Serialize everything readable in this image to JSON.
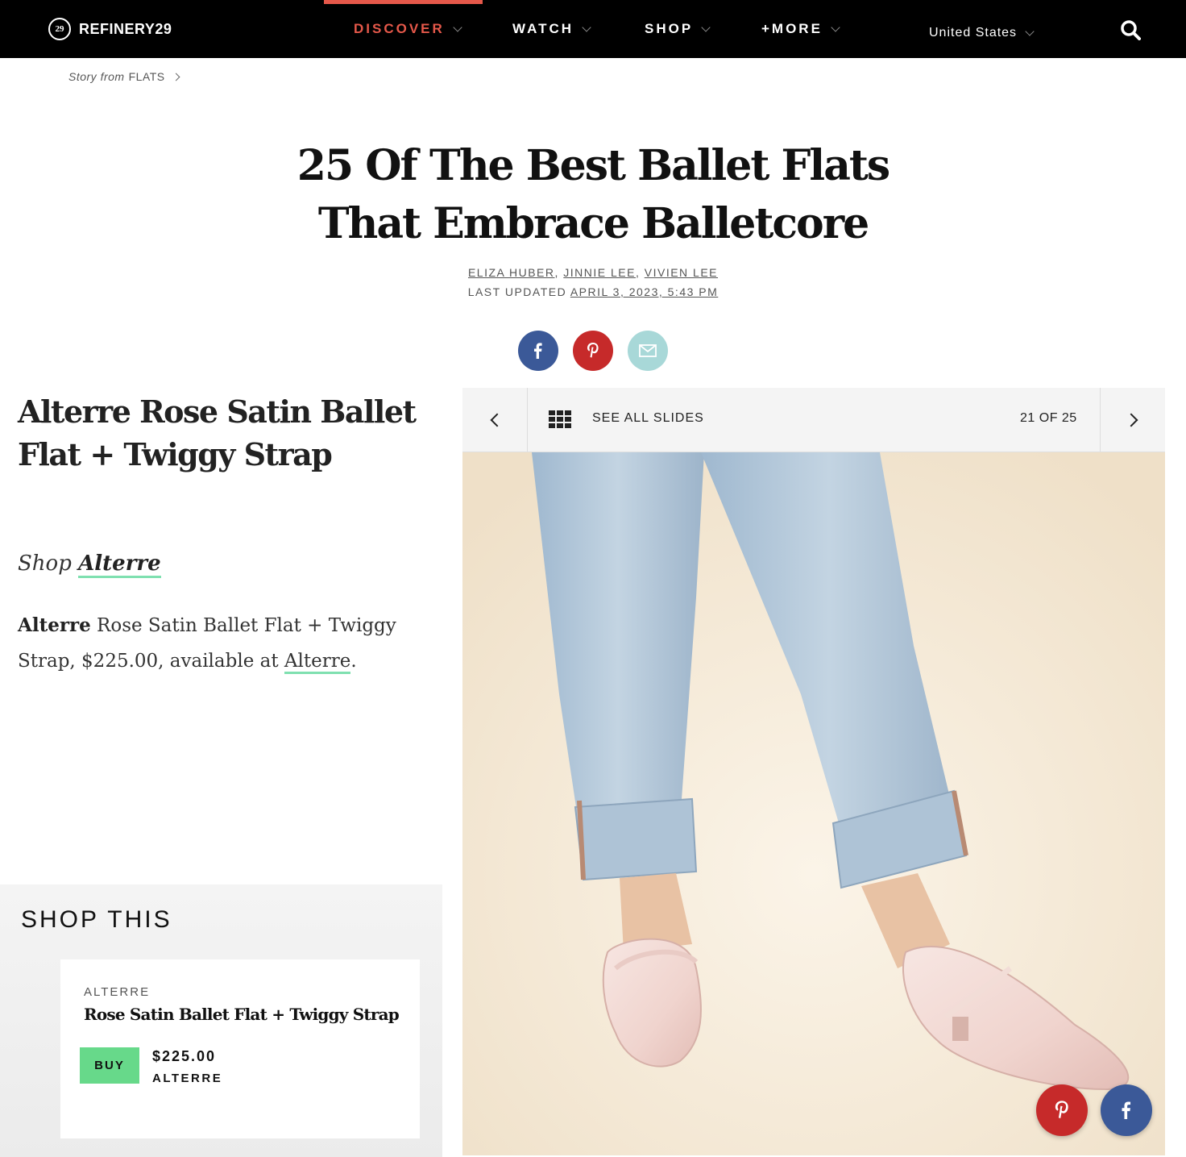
{
  "header": {
    "logo_text": "REFINERY29",
    "logo_mark": "29",
    "nav": [
      {
        "label": "DISCOVER",
        "active": true
      },
      {
        "label": "WATCH",
        "active": false
      },
      {
        "label": "SHOP",
        "active": false
      },
      {
        "label": "+MORE",
        "active": false
      }
    ],
    "region": "United States",
    "search_icon": "search-icon",
    "accent_color": "#e5584a"
  },
  "breadcrumb": {
    "prefix": "Story from",
    "section": "FLATS"
  },
  "article": {
    "title": "25 Of The Best Ballet Flats That Embrace Balletcore",
    "authors": [
      "ELIZA HUBER",
      "JINNIE LEE",
      "VIVIEN LEE"
    ],
    "updated_label": "LAST UPDATED",
    "updated_date": "APRIL 3, 2023, 5:43 PM"
  },
  "share": {
    "facebook_color": "#3b5998",
    "pinterest_color": "#c62a2a",
    "email_color": "#a8d8d8"
  },
  "slide": {
    "title": "Alterre Rose Satin Ballet Flat + Twiggy Strap",
    "shop_prefix": "Shop",
    "shop_brand": "Alterre",
    "desc_brand": "Alterre",
    "desc_text": " Rose Satin Ballet Flat + Twiggy Strap, $225.00, available at ",
    "desc_link": "Alterre",
    "desc_end": "."
  },
  "shop_this": {
    "heading": "SHOP THIS",
    "brand": "ALTERRE",
    "product_name": "Rose Satin Ballet Flat + Twiggy Strap",
    "buy_label": "BUY",
    "price": "$225.00",
    "retailer": "ALTERRE",
    "buy_color": "#67d98a"
  },
  "slideshow": {
    "see_all": "SEE ALL SLIDES",
    "counter": "21 OF 25",
    "current": 21,
    "total": 25
  }
}
